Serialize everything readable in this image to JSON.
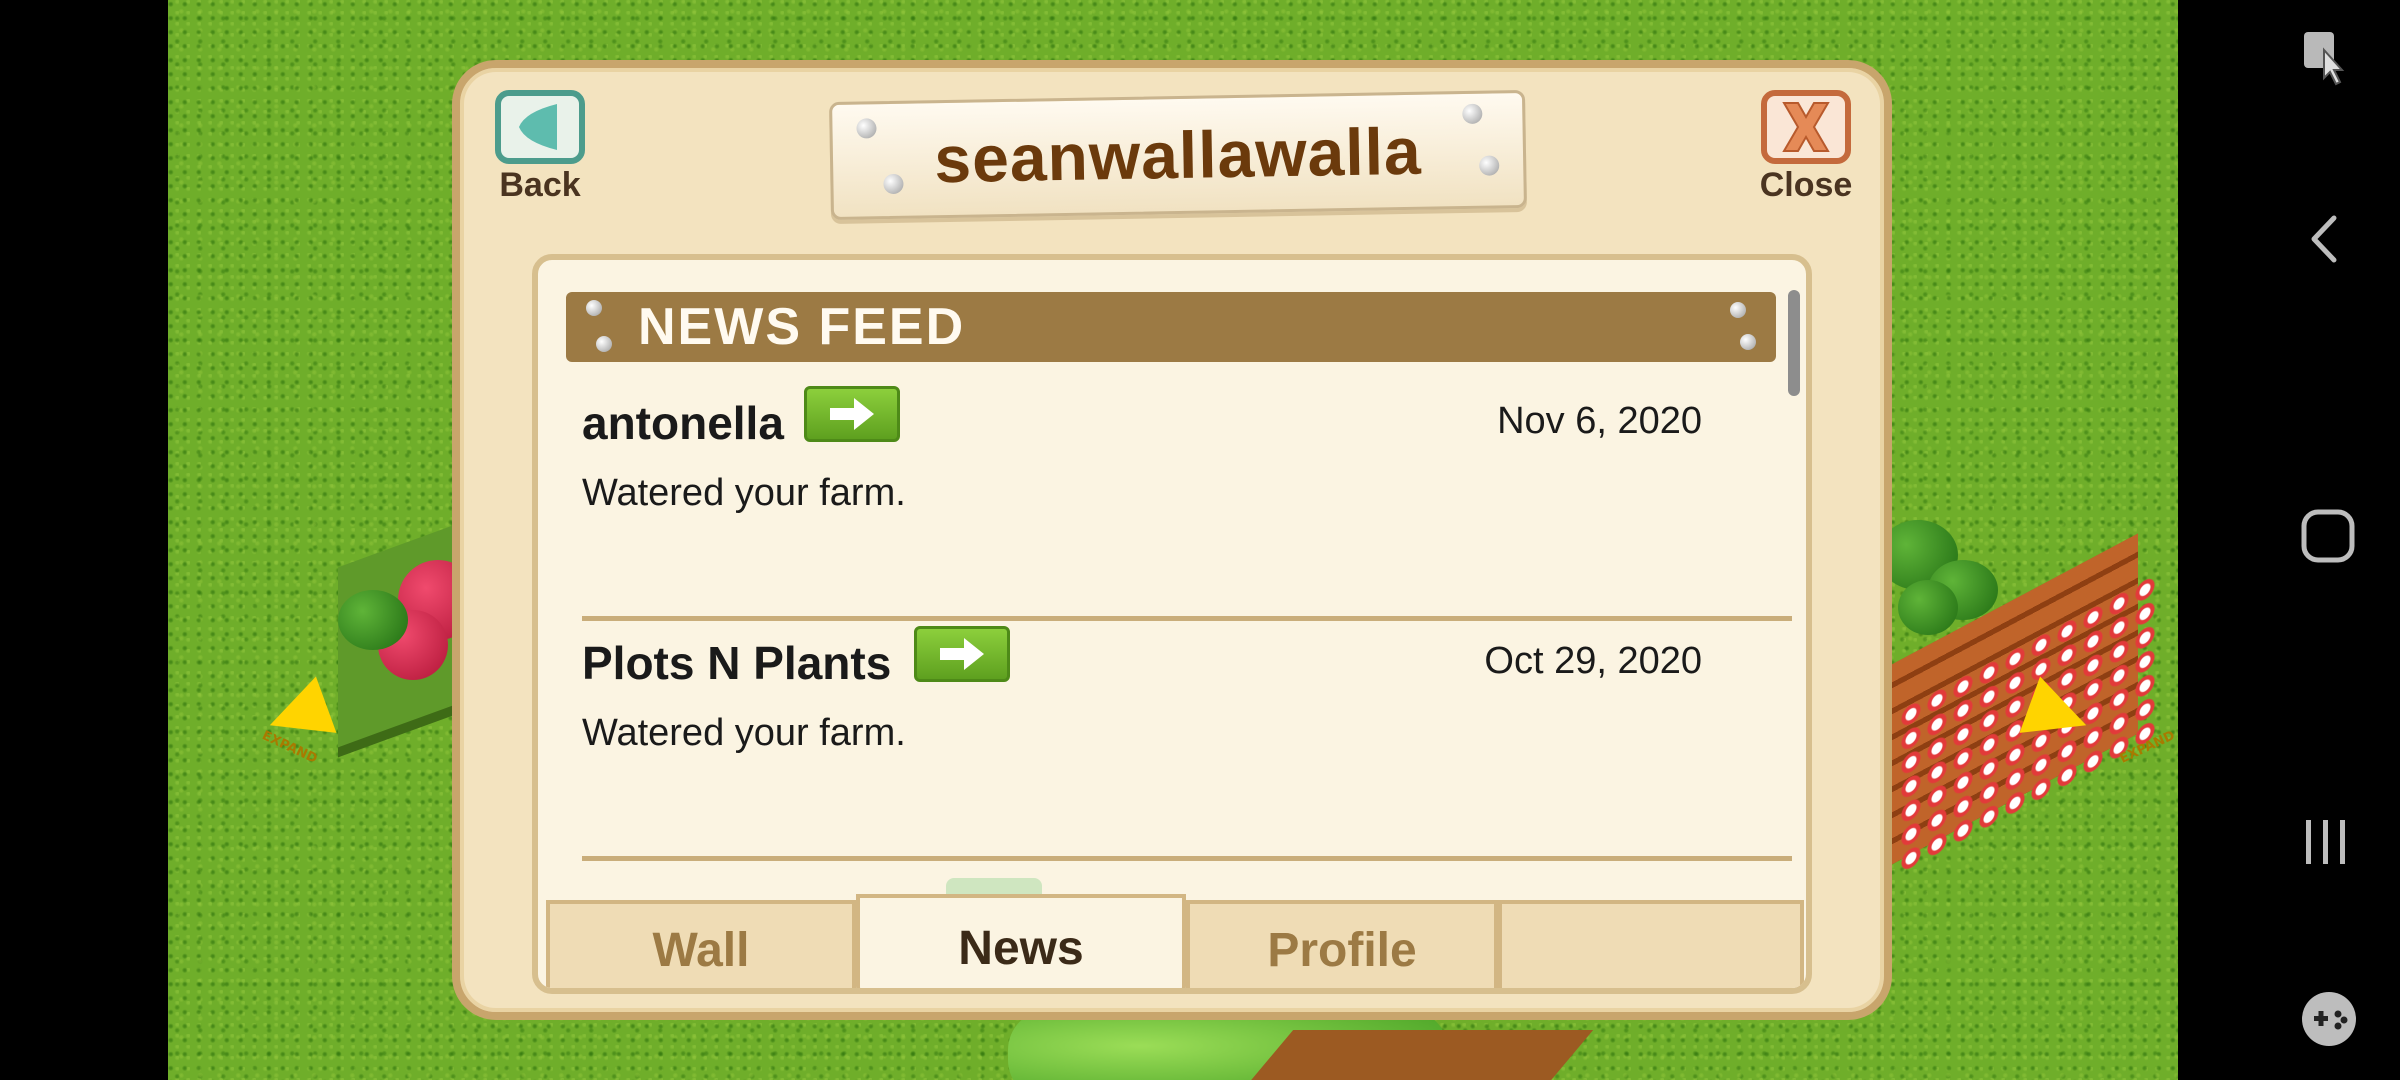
{
  "dialog": {
    "title": "seanwallawalla",
    "back_label": "Back",
    "close_label": "Close"
  },
  "news_feed": {
    "heading": "NEWS FEED",
    "items": [
      {
        "name": "antonella",
        "date": "Nov 6, 2020",
        "message": "Watered your farm."
      },
      {
        "name": "Plots N Plants",
        "date": "Oct 29, 2020",
        "message": "Watered your farm."
      }
    ]
  },
  "tabs": [
    {
      "label": "Wall",
      "active": false
    },
    {
      "label": "News",
      "active": true
    },
    {
      "label": "Profile",
      "active": false
    },
    {
      "label": "",
      "active": false
    }
  ],
  "map": {
    "expand_label": "EXPAND"
  },
  "system_nav": {
    "icons": [
      "screen-capture-icon",
      "back-nav-icon",
      "home-nav-icon",
      "recents-nav-icon",
      "game-controller-icon"
    ]
  },
  "colors": {
    "dialog_bg": "#f3e3bf",
    "banner_bg": "#9c7a44",
    "title_text": "#6b3a0c",
    "arrow_green": "#6fb02a",
    "grass": "#6fae2a"
  }
}
